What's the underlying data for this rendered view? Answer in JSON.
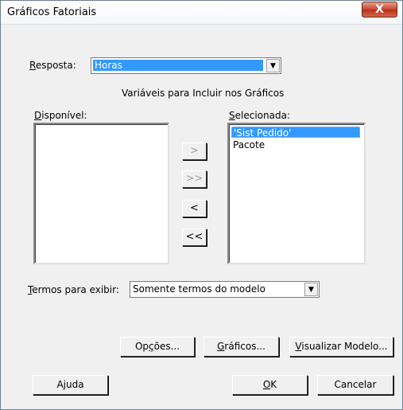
{
  "window": {
    "title": "Gráficos Fatoriais",
    "close_icon": "X"
  },
  "response": {
    "label": "Resposta:",
    "value": "Horas"
  },
  "section_heading": "Variáveis para Incluir nos Gráficos",
  "available": {
    "label": "Disponível:",
    "items": []
  },
  "selected": {
    "label": "Selecionada:",
    "items": [
      "'Sist Pedido'",
      "Pacote"
    ]
  },
  "move_buttons": {
    "add": ">",
    "add_all": ">>",
    "remove": "<",
    "remove_all": "<<"
  },
  "terms": {
    "label": "Termos para exibir:",
    "value": "Somente termos do modelo"
  },
  "buttons": {
    "options": "Opções...",
    "graphs": "Gráficos...",
    "view_model": "Visualizar Modelo...",
    "help": "Ajuda",
    "ok": "OK",
    "cancel": "Cancelar"
  },
  "colors": {
    "selection": "#3399ff",
    "dialog": "#f0f0f0",
    "close": "#c8452d"
  }
}
